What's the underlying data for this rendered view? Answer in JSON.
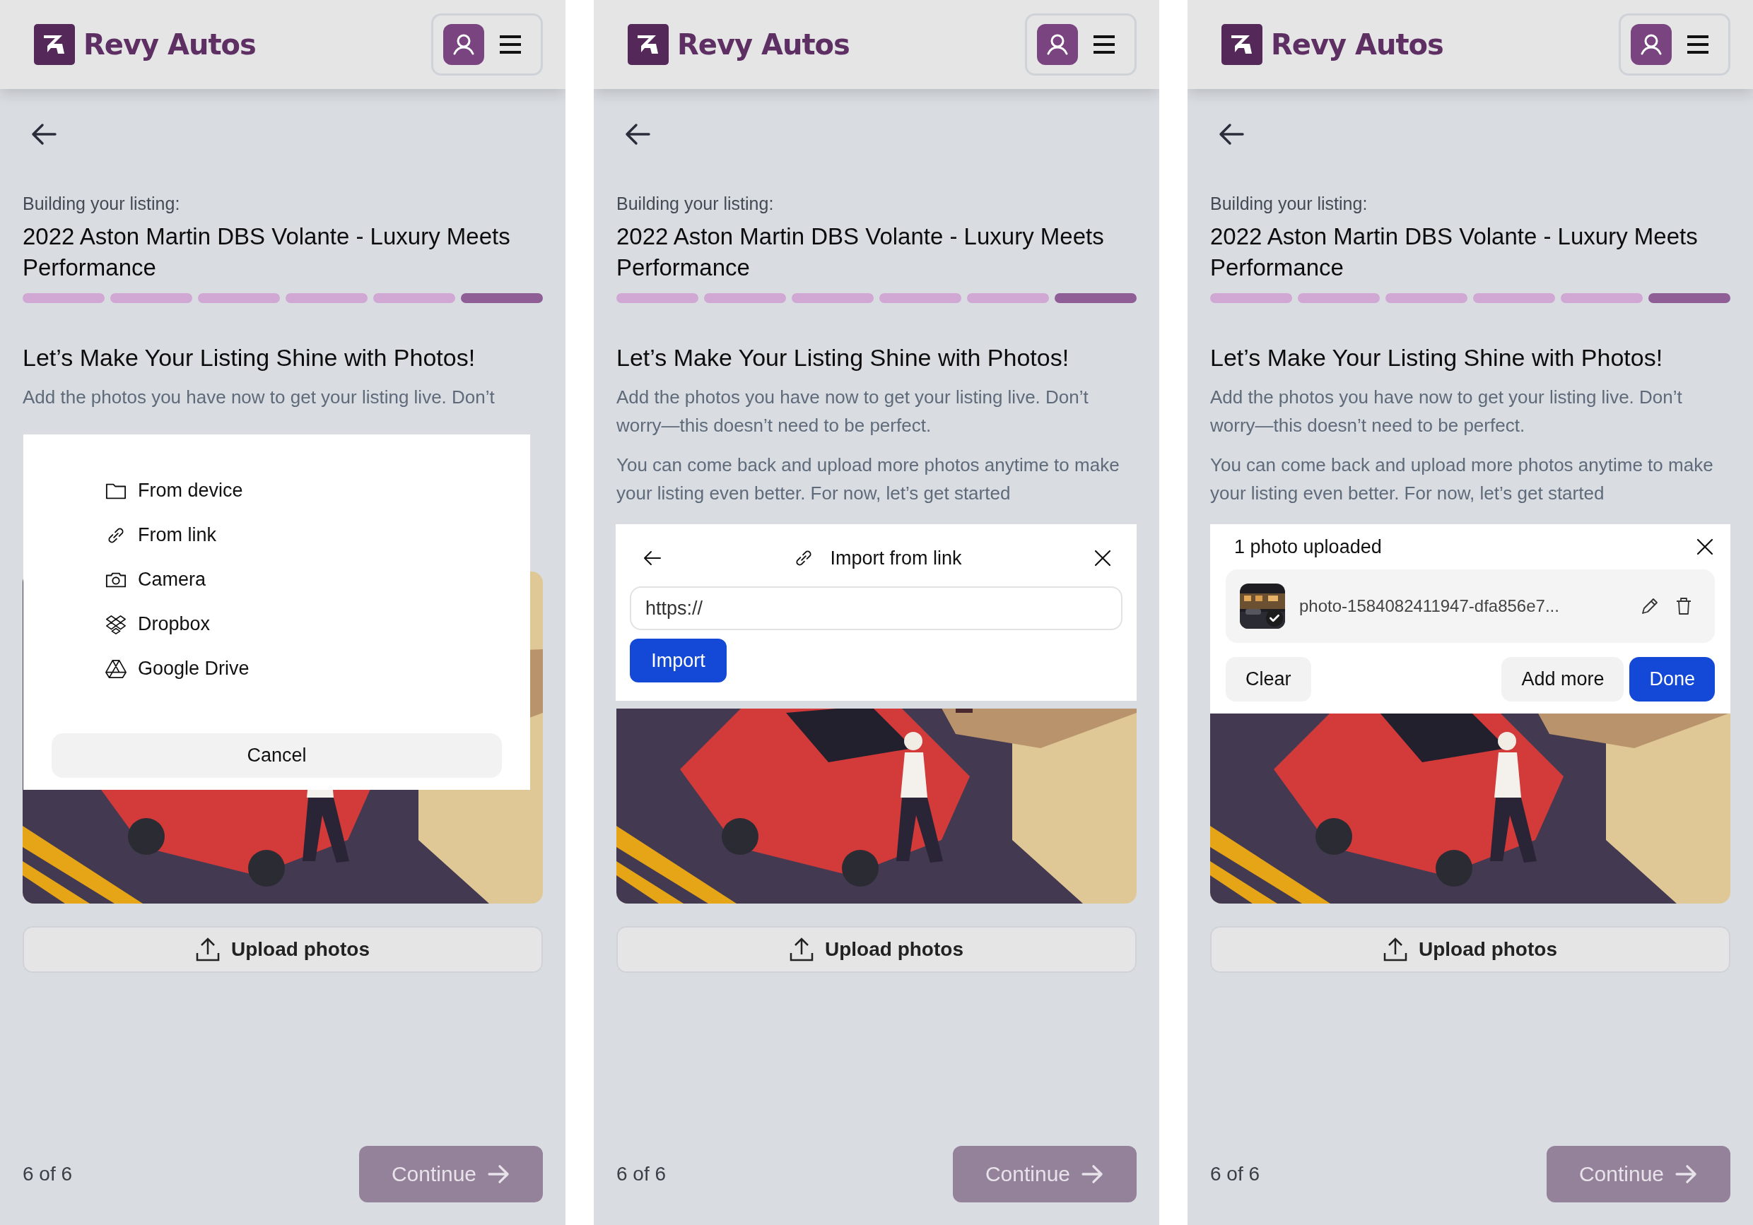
{
  "panels": [
    {
      "brand": "Revy Autos",
      "listing_label": "Building your listing:",
      "listing_title": "2022 Aston Martin DBS Volante - Luxury Meets Performance",
      "steps": [
        {
          "current": false
        },
        {
          "current": false
        },
        {
          "current": false
        },
        {
          "current": false
        },
        {
          "current": false
        },
        {
          "current": true
        }
      ],
      "heading": "Let’s Make Your Listing Shine with Photos!",
      "paragraphs": [
        "Add the photos you have now to get your listing live. Don’t"
      ],
      "upload_button": "Upload photos",
      "step_count": "6 of 6",
      "continue_button": {
        "label": "Continue",
        "disabled": true
      },
      "overlay": {
        "kind": "source_menu",
        "options": [
          "From device",
          "From link",
          "Camera",
          "Dropbox",
          "Google Drive"
        ],
        "cancel": "Cancel"
      }
    },
    {
      "brand": "Revy Autos",
      "listing_label": "Building your listing:",
      "listing_title": "2022 Aston Martin DBS Volante - Luxury Meets Performance",
      "steps": [
        {
          "current": false
        },
        {
          "current": false
        },
        {
          "current": false
        },
        {
          "current": false
        },
        {
          "current": false
        },
        {
          "current": true
        }
      ],
      "heading": "Let’s Make Your Listing Shine with Photos!",
      "paragraphs": [
        "Add the photos you have now to get your listing live. Don’t worry—this doesn’t need to be perfect.",
        "You can come back and upload more photos anytime to make your listing even better. For now, let’s get started"
      ],
      "upload_button": "Upload photos",
      "step_count": "6 of 6",
      "continue_button": {
        "label": "Continue",
        "disabled": true
      },
      "overlay": {
        "kind": "link_import",
        "title": "Import from link",
        "url": "https://",
        "button": "Import"
      }
    },
    {
      "brand": "Revy Autos",
      "listing_label": "Building your listing:",
      "listing_title": "2022 Aston Martin DBS Volante - Luxury Meets Performance",
      "steps": [
        {
          "current": false
        },
        {
          "current": false
        },
        {
          "current": false
        },
        {
          "current": false
        },
        {
          "current": false
        },
        {
          "current": true
        }
      ],
      "heading": "Let’s Make Your Listing Shine with Photos!",
      "paragraphs": [
        "Add the photos you have now to get your listing live. Don’t worry—this doesn’t need to be perfect.",
        "You can come back and upload more photos anytime to make your listing even better. For now, let’s get started"
      ],
      "upload_button": "Upload photos",
      "step_count": "6 of 6",
      "continue_button": {
        "label": "Continue",
        "disabled": true
      },
      "overlay": {
        "kind": "upload_summary",
        "title": "1 photo uploaded",
        "file": {
          "name": "photo-1584082411947-dfa856e7...",
          "uploaded": true
        },
        "buttons": [
          {
            "label": "Clear",
            "primary": false
          },
          {
            "label": "Add more",
            "primary": false
          },
          {
            "label": "Done",
            "primary": true
          }
        ]
      }
    }
  ]
}
